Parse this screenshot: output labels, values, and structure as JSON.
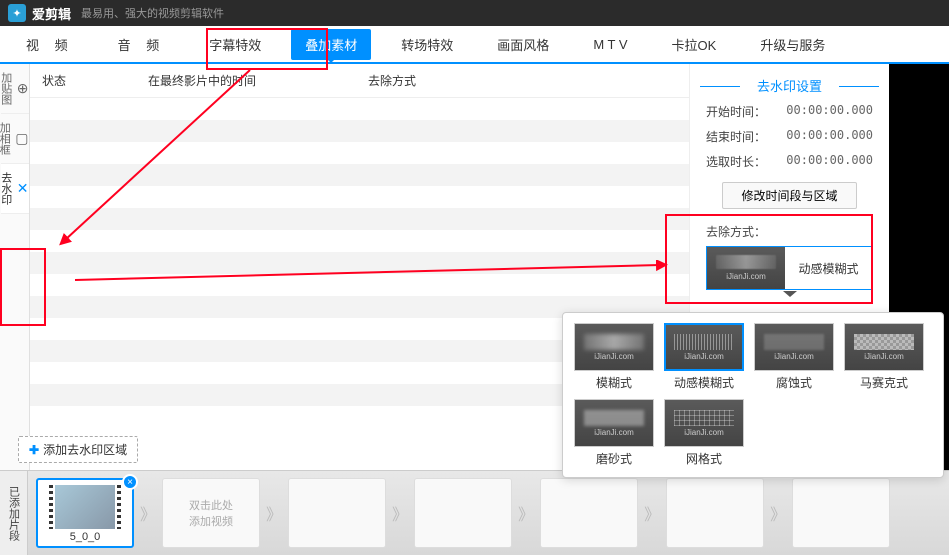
{
  "titlebar": {
    "app_name": "爱剪辑",
    "subtitle": "最易用、强大的视频剪辑软件"
  },
  "main_tabs": [
    "视 频",
    "音 频",
    "字幕特效",
    "叠加素材",
    "转场特效",
    "画面风格",
    "M T V",
    "卡拉OK",
    "升级与服务"
  ],
  "main_tab_active": 3,
  "side_tabs": [
    {
      "icon": "⊕",
      "label": "加贴图"
    },
    {
      "icon": "▢",
      "label": "加相框"
    },
    {
      "icon": "✕",
      "label": "去水印"
    }
  ],
  "side_tab_active": 2,
  "table": {
    "headers": {
      "state": "状态",
      "time": "在最终影片中的时间",
      "remove_method": "去除方式"
    }
  },
  "right_panel": {
    "title": "去水印设置",
    "fields": {
      "start_label": "开始时间：",
      "start_value": "00:00:00.000",
      "end_label": "结束时间：",
      "end_value": "00:00:00.000",
      "duration_label": "选取时长：",
      "duration_value": "00:00:00.000"
    },
    "modify_btn": "修改时间段与区域",
    "remove_label": "去除方式：",
    "selected_effect": {
      "name": "动感模糊式",
      "watermark": "iJianJi.com"
    }
  },
  "add_region_btn": "添加去水印区域",
  "timeline": {
    "label": "已添加片段",
    "clip": {
      "name": "5_0_0"
    },
    "empty_hint_line1": "双击此处",
    "empty_hint_line2": "添加视频"
  },
  "effects_popup": {
    "items": [
      {
        "name": "模糊式",
        "watermark": "iJianJi.com",
        "preset": "blur"
      },
      {
        "name": "动感模糊式",
        "watermark": "iJianJi.com",
        "preset": "motion",
        "selected": true
      },
      {
        "name": "腐蚀式",
        "watermark": "iJianJi.com",
        "preset": "corrode"
      },
      {
        "name": "马赛克式",
        "watermark": "iJianJi.com",
        "preset": "mosaic"
      },
      {
        "name": "磨砂式",
        "watermark": "iJianJi.com",
        "preset": "frost"
      },
      {
        "name": "网格式",
        "watermark": "iJianJi.com",
        "preset": "grid"
      }
    ]
  }
}
